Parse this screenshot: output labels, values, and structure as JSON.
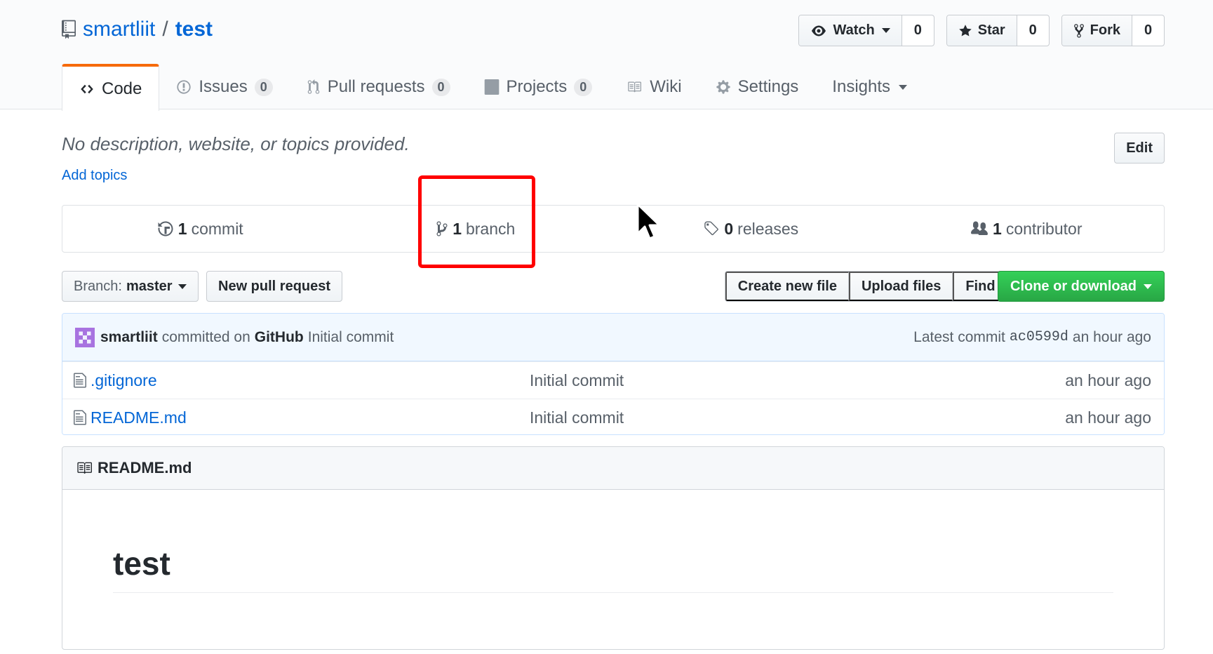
{
  "repo": {
    "owner": "smartliit",
    "separator": "/",
    "name": "test"
  },
  "actions": {
    "watch": {
      "label": "Watch",
      "count": "0"
    },
    "star": {
      "label": "Star",
      "count": "0"
    },
    "fork": {
      "label": "Fork",
      "count": "0"
    }
  },
  "nav": {
    "code": "Code",
    "issues": {
      "label": "Issues",
      "count": "0"
    },
    "pulls": {
      "label": "Pull requests",
      "count": "0"
    },
    "projects": {
      "label": "Projects",
      "count": "0"
    },
    "wiki": "Wiki",
    "settings": "Settings",
    "insights": "Insights"
  },
  "description": {
    "text": "No description, website, or topics provided.",
    "add_topics": "Add topics",
    "edit": "Edit"
  },
  "summary": {
    "commits": {
      "num": "1",
      "label": "commit"
    },
    "branches": {
      "num": "1",
      "label": "branch"
    },
    "releases": {
      "num": "0",
      "label": "releases"
    },
    "contributors": {
      "num": "1",
      "label": "contributor"
    }
  },
  "filenav": {
    "branch_label": "Branch:",
    "branch_value": "master",
    "new_pr": "New pull request",
    "create_file": "Create new file",
    "upload_files": "Upload files",
    "find_file": "Find file",
    "clone": "Clone or download"
  },
  "commit": {
    "author": "smartliit",
    "committed_on": "committed on",
    "platform": "GitHub",
    "message": "Initial commit",
    "latest_label": "Latest commit",
    "sha": "ac0599d",
    "age": "an hour ago"
  },
  "files": [
    {
      "name": ".gitignore",
      "message": "Initial commit",
      "age": "an hour ago"
    },
    {
      "name": "README.md",
      "message": "Initial commit",
      "age": "an hour ago"
    }
  ],
  "readme": {
    "filename": "README.md",
    "heading": "test"
  },
  "colors": {
    "accent": "#0366d6",
    "tab_highlight": "#f66a0a",
    "clone_green": "#28a745",
    "annotation_red": "#ff0000"
  }
}
